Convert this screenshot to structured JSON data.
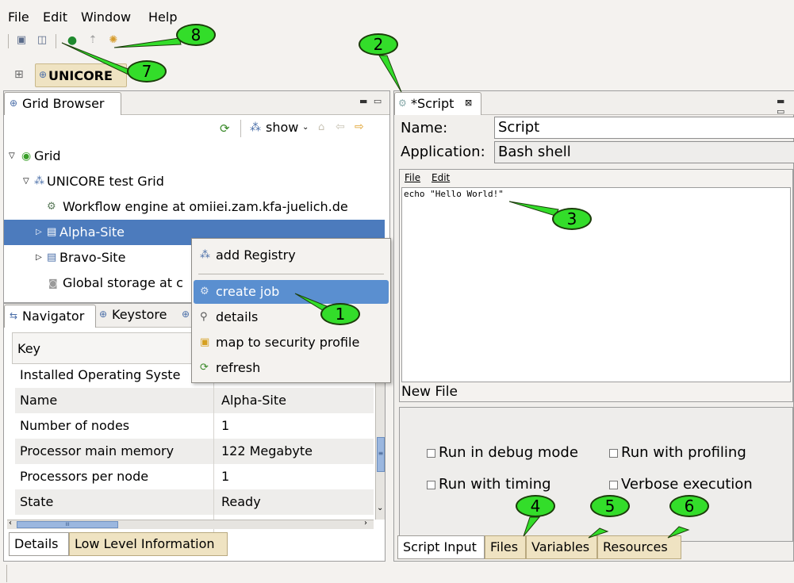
{
  "menubar": {
    "file": "File",
    "edit": "Edit",
    "window": "Window",
    "help": "Help"
  },
  "perspective": {
    "label": "UNICORE"
  },
  "grid_browser": {
    "tab_title": "Grid Browser",
    "show_label": "show",
    "tree": [
      {
        "label": "Grid"
      },
      {
        "label": "UNICORE test Grid"
      },
      {
        "label": "Workflow engine at omiiei.zam.kfa-juelich.de"
      },
      {
        "label": "Alpha-Site"
      },
      {
        "label": "Bravo-Site"
      },
      {
        "label": "Global storage at c"
      }
    ]
  },
  "context_menu": {
    "items": [
      {
        "label": "add Registry"
      },
      {
        "label": "create job"
      },
      {
        "label": "details"
      },
      {
        "label": "map to security profile"
      },
      {
        "label": "refresh"
      }
    ]
  },
  "details_panel": {
    "tabs": [
      "Navigator",
      "Keystore"
    ],
    "col_key": "Key",
    "rows": [
      {
        "key": "Installed Operating Syste",
        "value": ""
      },
      {
        "key": "Name",
        "value": "Alpha-Site"
      },
      {
        "key": "Number of nodes",
        "value": "1"
      },
      {
        "key": "Processor main memory",
        "value": "122 Megabyte"
      },
      {
        "key": "Processors per node",
        "value": "1"
      },
      {
        "key": "State",
        "value": "Ready"
      }
    ],
    "scroll_grip": "III",
    "bottom_tabs": [
      "Details",
      "Low Level Information"
    ]
  },
  "script_editor": {
    "tab_title": "*Script",
    "name_label": "Name:",
    "name_value": "Script",
    "application_label": "Application:",
    "application_value": "Bash shell",
    "inner_menu": {
      "file": "File",
      "edit": "Edit"
    },
    "code": "echo \"Hello World!\"",
    "new_file_label": "New File",
    "options": [
      {
        "label": "Run in debug mode"
      },
      {
        "label": "Run with profiling"
      },
      {
        "label": "Run with timing"
      },
      {
        "label": "Verbose execution"
      }
    ],
    "bottom_tabs": [
      "Script Input",
      "Files",
      "Variables",
      "Resources"
    ]
  },
  "callouts": [
    "1",
    "2",
    "3",
    "4",
    "5",
    "6",
    "7",
    "8"
  ],
  "colors": {
    "selection": "#4c7bbd",
    "menu_highlight": "#5a8fd0",
    "callout_fill": "#33dd2a",
    "tab_tan": "#efe3c2"
  }
}
